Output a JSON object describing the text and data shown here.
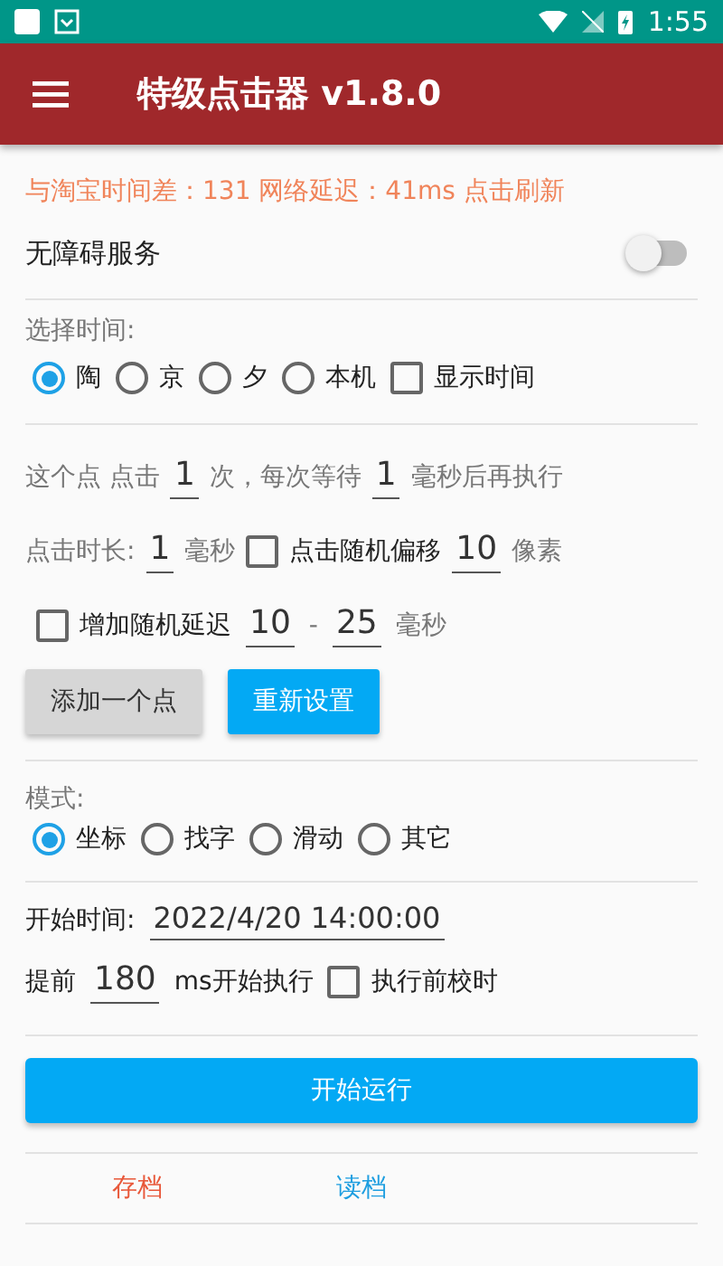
{
  "status_bar": {
    "time": "1:55"
  },
  "app_bar": {
    "title": "特级点击器 v1.8.0"
  },
  "sync_info": "与淘宝时间差：131 网络延迟：41ms  点击刷新",
  "accessibility": {
    "label": "无障碍服务",
    "on": false
  },
  "time_select": {
    "label": "选择时间:",
    "options": [
      {
        "label": "陶",
        "selected": true
      },
      {
        "label": "京",
        "selected": false
      },
      {
        "label": "夕",
        "selected": false
      },
      {
        "label": "本机",
        "selected": false
      }
    ],
    "show_time": {
      "label": "显示时间",
      "checked": false
    }
  },
  "click_rows": [
    {
      "items": [
        {
          "kind": "text",
          "text": "这个点 点击",
          "muted": true
        },
        {
          "kind": "field",
          "value": "1"
        },
        {
          "kind": "text",
          "text": "次，每次等待",
          "muted": true
        },
        {
          "kind": "field",
          "value": "1"
        },
        {
          "kind": "text",
          "text": "毫秒后再执行",
          "muted": true
        }
      ]
    },
    {
      "items": [
        {
          "kind": "text",
          "text": "点击时长:",
          "muted": true
        },
        {
          "kind": "field",
          "value": "1"
        },
        {
          "kind": "text",
          "text": "毫秒",
          "muted": true
        },
        {
          "kind": "checkbox",
          "label": "点击随机偏移",
          "checked": false
        },
        {
          "kind": "field",
          "value": "10"
        },
        {
          "kind": "text",
          "text": "像素",
          "muted": true
        }
      ]
    },
    {
      "items": [
        {
          "kind": "checkbox",
          "label": "增加随机延迟",
          "checked": false
        },
        {
          "kind": "field",
          "value": "10"
        },
        {
          "kind": "text",
          "text": "-",
          "muted": true
        },
        {
          "kind": "field",
          "value": "25"
        },
        {
          "kind": "text",
          "text": "毫秒",
          "muted": true
        }
      ]
    }
  ],
  "buttons": [
    {
      "label": "添加一个点",
      "kind": "secondary"
    },
    {
      "label": "重新设置",
      "kind": "primary"
    }
  ],
  "mode": {
    "label": "模式:",
    "options": [
      {
        "label": "坐标",
        "selected": true
      },
      {
        "label": "找字",
        "selected": false
      },
      {
        "label": "滑动",
        "selected": false
      },
      {
        "label": "其它",
        "selected": false
      }
    ]
  },
  "start_rows": [
    {
      "items": [
        {
          "kind": "text",
          "text": "开始时间:",
          "muted": false
        },
        {
          "kind": "field",
          "value": "2022/4/20 14:00:00"
        }
      ]
    },
    {
      "items": [
        {
          "kind": "text",
          "text": "提前",
          "muted": false
        },
        {
          "kind": "field",
          "value": "180"
        },
        {
          "kind": "text",
          "text": "ms开始执行",
          "muted": false
        },
        {
          "kind": "checkbox",
          "label": "执行前校时",
          "checked": false
        }
      ]
    }
  ],
  "run_button": "开始运行",
  "bottom_tabs": [
    {
      "label": "存档",
      "color": "#e8583a"
    },
    {
      "label": "读档",
      "color": "#1e9ee0"
    }
  ]
}
